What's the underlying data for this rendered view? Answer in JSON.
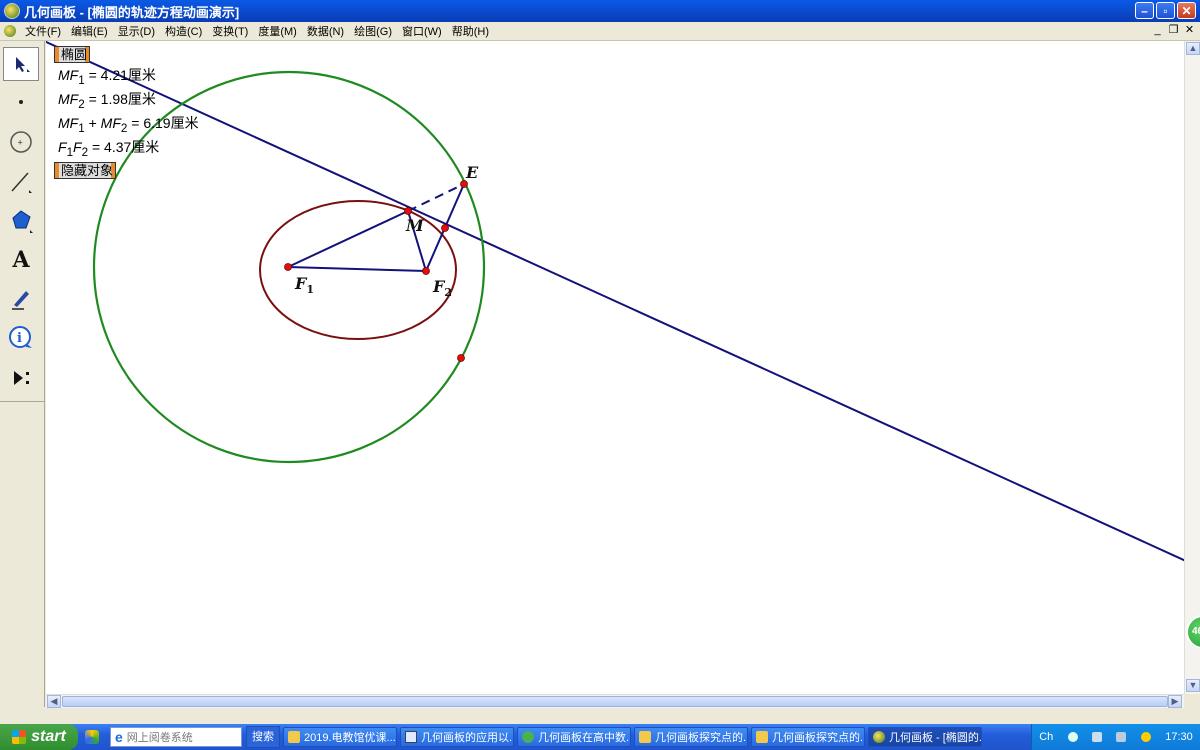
{
  "window": {
    "title": "几何画板 - [椭圆的轨迹方程动画演示]"
  },
  "menu": {
    "items": [
      "文件(F)",
      "编辑(E)",
      "显示(D)",
      "构造(C)",
      "变换(T)",
      "度量(M)",
      "数据(N)",
      "绘图(G)",
      "窗口(W)",
      "帮助(H)"
    ]
  },
  "canvas": {
    "ellipse_button": "椭圆",
    "hide_button": "隐藏对象",
    "measures": [
      {
        "lhs": "MF",
        "sub": "1",
        "rhs": " = 4.21厘米"
      },
      {
        "lhs": "MF",
        "sub": "2",
        "rhs": " = 1.98厘米"
      },
      {
        "lhs": "MF",
        "sub": "1",
        "mid": " + ",
        "lhs2": "MF",
        "sub2": "2",
        "rhs": " = 6.19厘米"
      },
      {
        "lhs": "F",
        "sub": "1",
        "lhs2": "F",
        "sub2": "2",
        "rhs": " = 4.37厘米"
      }
    ],
    "point_labels": {
      "E": "E",
      "M": "M",
      "F1": "F",
      "F1_sub": "1",
      "F2": "F",
      "F2_sub": "2"
    },
    "colors": {
      "circle": "#1f8a1f",
      "ellipse": "#7a0f0f",
      "lines": "#12127a",
      "points": "#e01010"
    }
  },
  "taskbar": {
    "start_label": "start",
    "search_placeholder": "网上阅卷系统",
    "search_button": "搜索",
    "tasks": [
      "2019.电教馆优课...",
      "几何画板的应用以...",
      "几何画板在高中数...",
      "几何画板探究点的...",
      "几何画板探究点的...",
      "几何画板 - [椭圆的..."
    ],
    "tray_ime": "Ch",
    "clock": "17:30",
    "badge": "46"
  }
}
